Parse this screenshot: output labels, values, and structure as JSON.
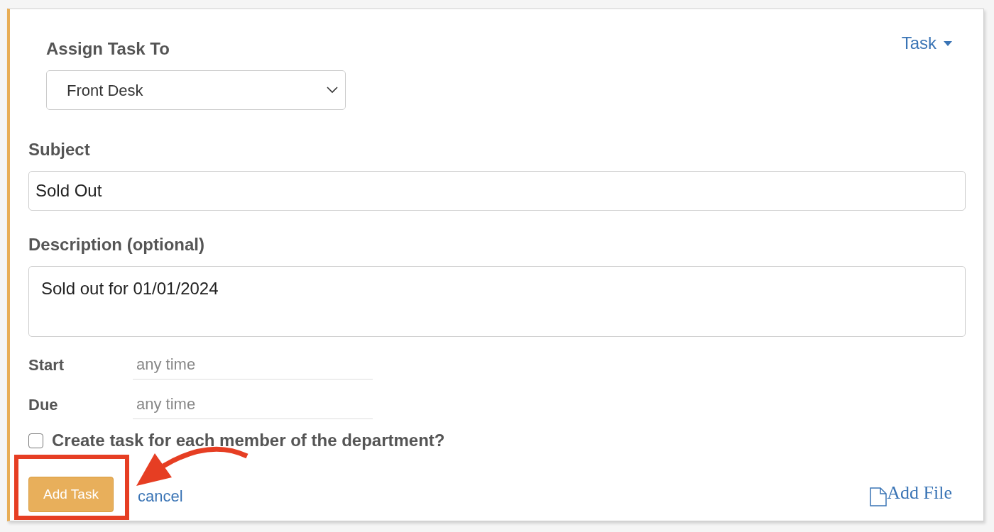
{
  "task_menu": {
    "label": "Task"
  },
  "assign": {
    "label": "Assign Task To",
    "value": "Front Desk"
  },
  "subject": {
    "label": "Subject",
    "value": "Sold Out"
  },
  "description": {
    "label": "Description (optional)",
    "value": "Sold out for 01/01/2024"
  },
  "dates": [
    {
      "label": "Start",
      "placeholder": "any time"
    },
    {
      "label": "Due",
      "placeholder": "any time"
    }
  ],
  "each_member": {
    "label": "Create task for each member of the department?",
    "checked": false
  },
  "actions": {
    "submit": "Add Task",
    "cancel": "cancel",
    "add_file": "Add File"
  },
  "annotation": {
    "highlight": true
  }
}
